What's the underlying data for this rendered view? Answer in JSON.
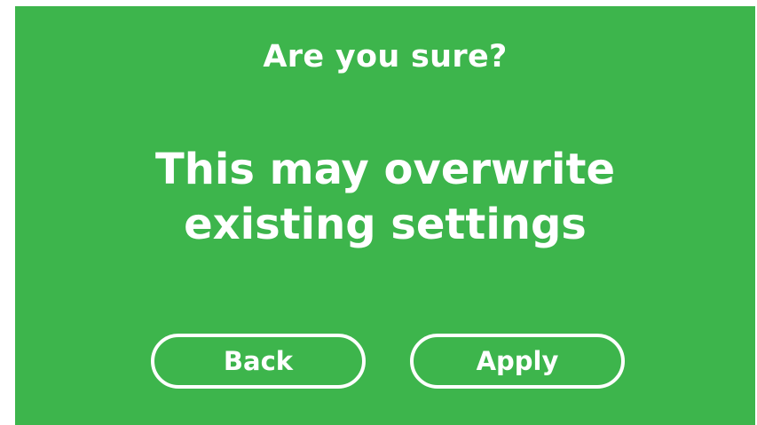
{
  "dialog": {
    "title": "Are you sure?",
    "message_line1": "This may overwrite",
    "message_line2": "existing settings",
    "back_label": "Back",
    "apply_label": "Apply"
  },
  "colors": {
    "background": "#3db54c",
    "text": "#ffffff"
  }
}
